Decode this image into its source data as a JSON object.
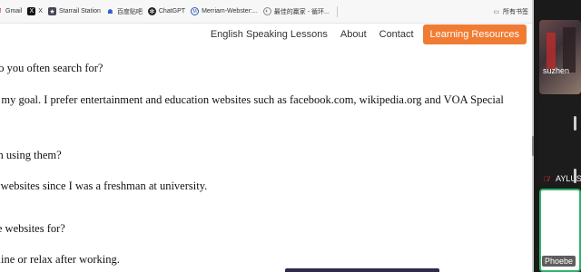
{
  "bookmarks": {
    "items": [
      {
        "label": "Gmail",
        "icon": "gmail-icon"
      },
      {
        "label": "X",
        "icon": "x-icon"
      },
      {
        "label": "Starrail Station",
        "icon": "starrail-icon"
      },
      {
        "label": "百度贴吧",
        "icon": "baidu-tieba-icon"
      },
      {
        "label": "ChatGPT",
        "icon": "chatgpt-icon"
      },
      {
        "label": "Merriam-Webster:...",
        "icon": "merriam-webster-icon"
      },
      {
        "label": "最佳的羸家 - 循环...",
        "icon": "page-icon"
      }
    ],
    "folder_label": "所有书签"
  },
  "nav": {
    "links": [
      "English Speaking Lessons",
      "About",
      "Contact"
    ],
    "cta": "Learning Resources",
    "cta_color": "#f07c33"
  },
  "content": {
    "lines": [
      "do you often search for?",
      "n my goal. I prefer entertainment and education websites such as facebook.com, wikipedia.org and VOA Special",
      "en using them?",
      "e websites since I was a freshman at university.",
      "se websites for?",
      "aline or relax after working."
    ]
  },
  "video": {
    "participants": [
      "suzhen",
      "AYLUS",
      "Phoebe"
    ],
    "active_speaker_color": "#2fb36b"
  }
}
